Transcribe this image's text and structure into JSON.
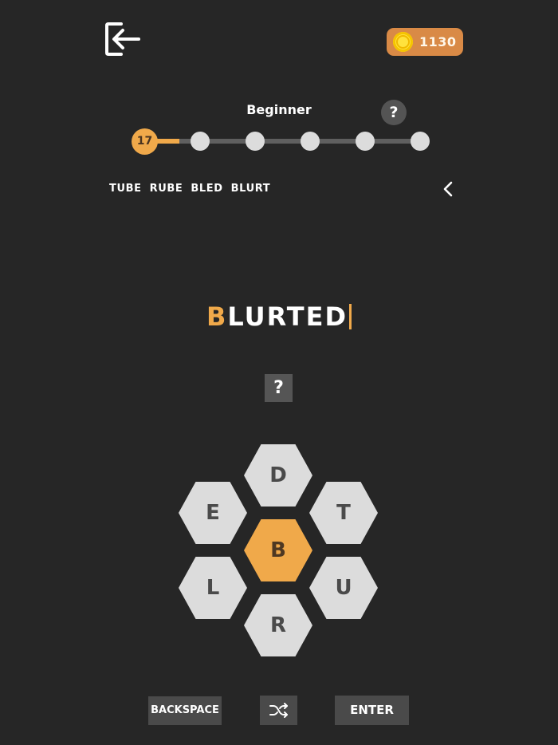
{
  "header": {
    "exit_icon": "exit-arrow-icon",
    "coins": {
      "icon": "coin-icon",
      "value": "1130",
      "color": "#d98a46"
    }
  },
  "level": {
    "title": "Beginner",
    "help_label": "?",
    "current": "17",
    "progress_steps_total": 6,
    "progress_steps_done": 1,
    "accent_color": "#f0a94a"
  },
  "found_words": [
    "TUBE",
    "RUBE",
    "BLED",
    "BLURT"
  ],
  "found_words_toggle_icon": "chevron-left-icon",
  "input": {
    "first_letter": "B",
    "rest": "LURTED"
  },
  "hint": {
    "label": "?"
  },
  "letters": {
    "center": "B",
    "top": "D",
    "upper_left": "E",
    "upper_right": "T",
    "lower_left": "L",
    "lower_right": "U",
    "bottom": "R"
  },
  "controls": {
    "backspace_label": "BACKSPACE",
    "shuffle_icon": "shuffle-icon",
    "enter_label": "ENTER"
  }
}
